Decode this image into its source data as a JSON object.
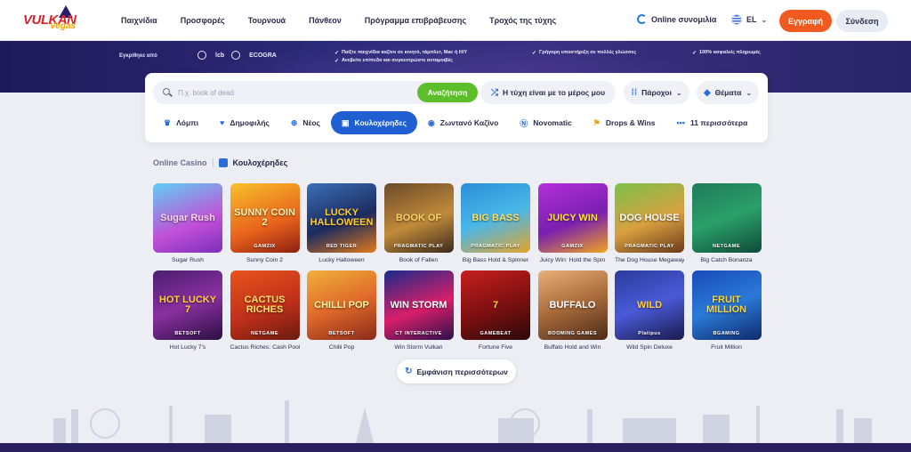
{
  "nav": {
    "logo_text": "VULKAN",
    "logo_sub": "Vegas",
    "links": [
      "Παιχνίδια",
      "Προσφορές",
      "Τουρνουά",
      "Πάνθεον",
      "Πρόγραμμα επιβράβευσης",
      "Τροχός της τύχης"
    ],
    "online_chat": "Online συνομιλία",
    "language": "EL",
    "register": "Εγγραφή",
    "login": "Σύνδεση"
  },
  "banner": {
    "approved_by": "Εγκρίθηκε από",
    "licenses": [
      "",
      "lcb",
      "",
      "ECOGRA"
    ],
    "features": [
      "Παίξτε παιχνίδια καζίνο σε κινητό, τάμπλετ, Mac ή Η/Υ",
      "Ανεβείτε επίπεδο και συγκεντρώστε ανταμοιβές",
      "Γρήγορη υποστήριξη σε πολλές γλώσσες",
      "100% ασφαλείς πληρωμές"
    ]
  },
  "search": {
    "placeholder": "Π.χ. book of dead",
    "button": "Αναζήτηση",
    "random": "Η τύχη είναι με το μέρος μου",
    "providers": "Πάροχοι",
    "themes": "Θέματα"
  },
  "categories": [
    {
      "label": "Λόμπι",
      "icon": "crown-icon"
    },
    {
      "label": "Δημοφιλής",
      "icon": "heart-icon"
    },
    {
      "label": "Νέος",
      "icon": "plus-icon"
    },
    {
      "label": "Κουλοχέρηδες",
      "icon": "slot-icon",
      "active": true
    },
    {
      "label": "Ζωντανό Καζίνο",
      "icon": "live-icon"
    },
    {
      "label": "Novomatic",
      "icon": "novomatic-icon"
    },
    {
      "label": "Drops & Wins",
      "icon": "drops-icon"
    },
    {
      "label": "11 περισσότερα",
      "icon": "more-icon"
    }
  ],
  "breadcrumb": {
    "root": "Online Casino",
    "current": "Κουλοχέρηδες"
  },
  "games": [
    {
      "name": "Sugar Rush",
      "title": "Sugar Rush",
      "provider": "",
      "bg": "linear-gradient(160deg,#5fd0f2,#c24fd8 60%,#7a2fb8)",
      "tc": "#ffd8f4"
    },
    {
      "name": "Sunny Coin 2",
      "title": "SUNNY COIN 2",
      "provider": "GAMZIX",
      "bg": "linear-gradient(160deg,#f8c12a,#e8611c 60%,#8c1f10)",
      "tc": "#fff2b0"
    },
    {
      "name": "Lucky Halloween",
      "title": "LUCKY HALLOWEEN",
      "provider": "RED TIGER",
      "bg": "linear-gradient(160deg,#3b6fb8,#1c2b5e 55%,#e07a1a)",
      "tc": "#ffcc33"
    },
    {
      "name": "Book of Fallen",
      "title": "BOOK OF",
      "provider": "PRAGMATIC PLAY",
      "bg": "linear-gradient(160deg,#6b4a2a,#c28a3a 55%,#3a2a1a)",
      "tc": "#ffd36a"
    },
    {
      "name": "Big Bass Hold & Spinner",
      "title": "BIG BASS",
      "provider": "PRAGMATIC PLAY",
      "bg": "linear-gradient(160deg,#2a8fd8,#4ab7e8 50%,#e3a52a)",
      "tc": "#ffe066"
    },
    {
      "name": "Juicy Win: Hold the Spin",
      "title": "JUICY WIN",
      "provider": "GAMZIX",
      "bg": "linear-gradient(160deg,#b32fd8,#7a1fb0 55%,#f0a51e)",
      "tc": "#ffe23a"
    },
    {
      "name": "The Dog House Megaways",
      "title": "DOG HOUSE",
      "provider": "PRAGMATIC PLAY",
      "bg": "linear-gradient(160deg,#7cc04a,#d8a040 55%,#6a3a1a)",
      "tc": "#ffffff"
    },
    {
      "name": "Big Catch Bonanza",
      "title": "",
      "provider": "NETGAME",
      "bg": "linear-gradient(160deg,#1f7a5a,#2aa06a 50%,#0f4a3a)",
      "tc": "#ffffff"
    },
    {
      "name": "Hot Lucky 7's",
      "title": "HOT LUCKY 7",
      "provider": "BETSOFT",
      "bg": "linear-gradient(160deg,#4a1f6e,#8a2fa0 50%,#2a1040)",
      "tc": "#ffd23a"
    },
    {
      "name": "Cactus Riches: Cash Pool",
      "title": "CACTUS RICHES",
      "provider": "NETGAME",
      "bg": "linear-gradient(160deg,#e8541c,#c0301a 55%,#6a1a10)",
      "tc": "#ffe066"
    },
    {
      "name": "Chilli Pop",
      "title": "CHILLI POP",
      "provider": "BETSOFT",
      "bg": "linear-gradient(160deg,#f0b13a,#e06a2a 50%,#8a2a1a)",
      "tc": "#fff3a0"
    },
    {
      "name": "Win Storm Vulkan",
      "title": "WIN STORM",
      "provider": "CT INTERACTIVE",
      "bg": "linear-gradient(160deg,#1a2a8a,#d81f6a 55%,#2a0f4a)",
      "tc": "#ffffff"
    },
    {
      "name": "Fortune Five",
      "title": "7",
      "provider": "GAMEBEAT",
      "bg": "linear-gradient(160deg,#c81f1f,#7a0f10 55%,#2a0a0a)",
      "tc": "#ffd23a"
    },
    {
      "name": "Buffalo Hold and Win",
      "title": "BUFFALO",
      "provider": "BOOMING GAMES",
      "bg": "linear-gradient(160deg,#e8b07a,#a86a3a 50%,#4a2a1a)",
      "tc": "#ffffff"
    },
    {
      "name": "Wild Spin Deluxe",
      "title": "WILD",
      "provider": "Platipus",
      "bg": "linear-gradient(160deg,#2a3a9a,#4a5ad8 50%,#1a1a4a)",
      "tc": "#ffd23a"
    },
    {
      "name": "Fruit Million",
      "title": "FRUIT MILLION",
      "provider": "BGAMING",
      "bg": "linear-gradient(160deg,#1a4ab8,#2a7ad8 50%,#0f2a6a)",
      "tc": "#ffd23a"
    }
  ],
  "show_more": "Εμφάνιση περισσότερων",
  "colors": {
    "accent_orange": "#f15a1f",
    "accent_blue": "#1f5fd1",
    "accent_green": "#5cbf2a",
    "banner": "#2c2a78"
  }
}
